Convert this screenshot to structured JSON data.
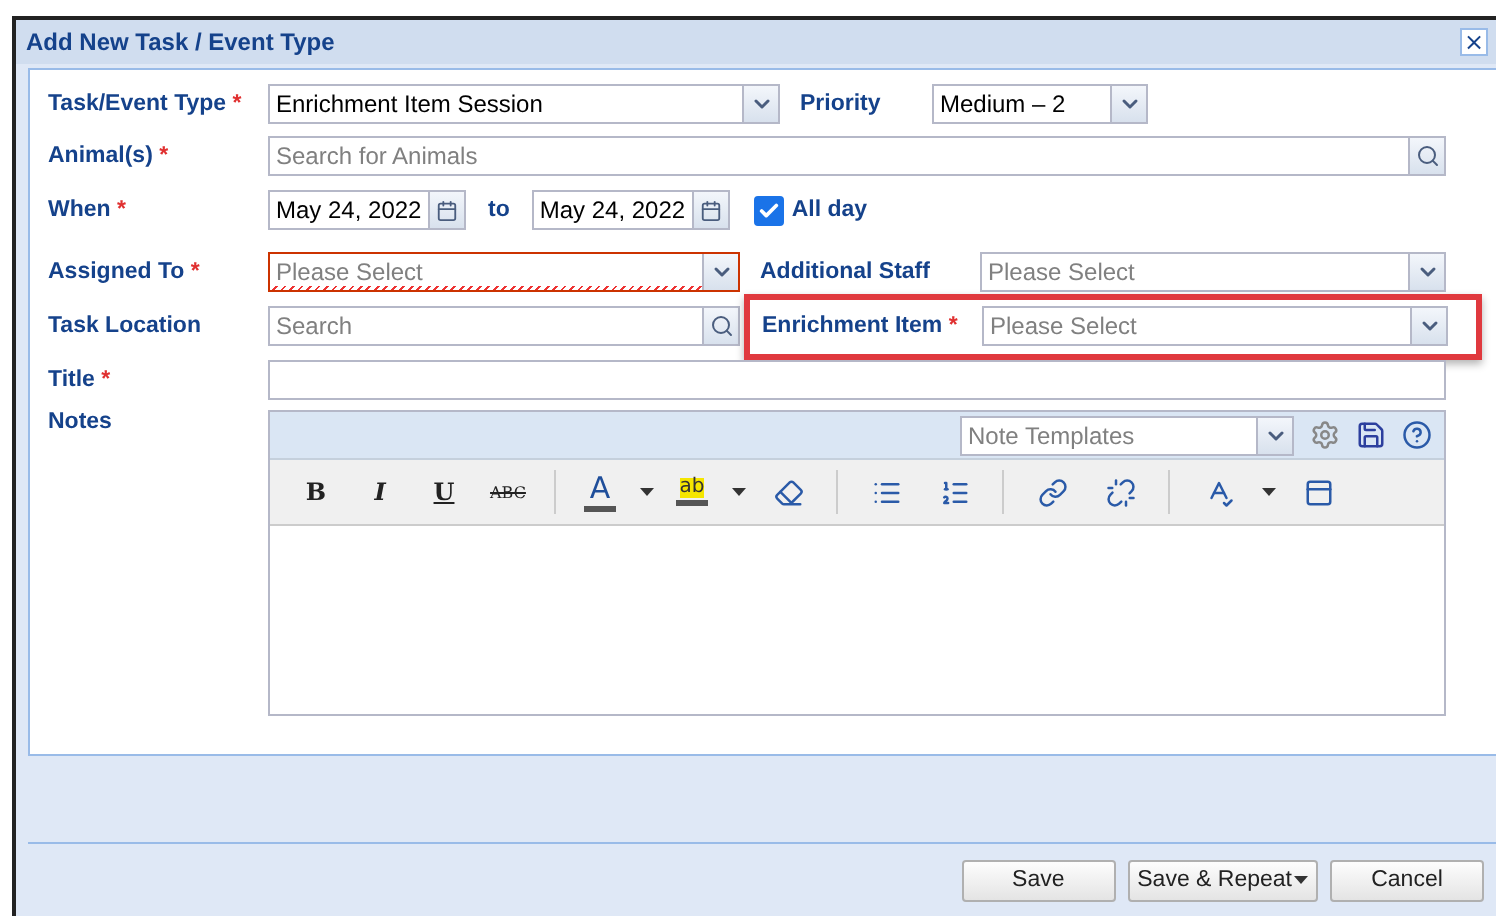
{
  "window": {
    "title": "Add New Task / Event Type",
    "close": "×"
  },
  "form": {
    "task_type": {
      "label": "Task/Event Type",
      "required_mark": "*",
      "value": "Enrichment Item Session"
    },
    "priority": {
      "label": "Priority",
      "value": "Medium – 2"
    },
    "animals": {
      "label": "Animal(s)",
      "required_mark": "*",
      "placeholder": "Search for Animals"
    },
    "when": {
      "label": "When",
      "required_mark": "*",
      "from": "May 24, 2022",
      "to_label": "to",
      "to": "May 24, 2022",
      "all_day": {
        "label": "All day",
        "checked": true
      }
    },
    "assigned_to": {
      "label": "Assigned To",
      "required_mark": "*",
      "placeholder": "Please Select",
      "invalid": true
    },
    "additional_staff": {
      "label": "Additional Staff",
      "placeholder": "Please Select"
    },
    "task_location": {
      "label": "Task Location",
      "placeholder": "Search"
    },
    "enrichment_item": {
      "label": "Enrichment Item",
      "required_mark": "*",
      "placeholder": "Please Select",
      "highlighted": true
    },
    "title": {
      "label": "Title",
      "required_mark": "*"
    },
    "notes": {
      "label": "Notes",
      "templates_placeholder": "Note Templates",
      "toolbar": [
        {
          "kind": "bold",
          "label": "B"
        },
        {
          "kind": "italic",
          "label": "I"
        },
        {
          "kind": "underline",
          "label": "U"
        },
        {
          "kind": "strike",
          "label": "ABC"
        },
        {
          "kind": "sep"
        },
        {
          "kind": "color",
          "label": "A"
        },
        {
          "kind": "caret"
        },
        {
          "kind": "highlight",
          "label": "ab"
        },
        {
          "kind": "caret"
        },
        {
          "kind": "eraser"
        },
        {
          "kind": "sep"
        },
        {
          "kind": "bullets"
        },
        {
          "kind": "numbers"
        },
        {
          "kind": "sep"
        },
        {
          "kind": "link"
        },
        {
          "kind": "unlink"
        },
        {
          "kind": "sep"
        },
        {
          "kind": "spellcheck"
        },
        {
          "kind": "caret"
        },
        {
          "kind": "source"
        }
      ]
    }
  },
  "buttons": [
    {
      "label": "Save",
      "caret": false
    },
    {
      "label": "Save & Repeat",
      "caret": true
    },
    {
      "label": "Cancel",
      "caret": false
    }
  ]
}
